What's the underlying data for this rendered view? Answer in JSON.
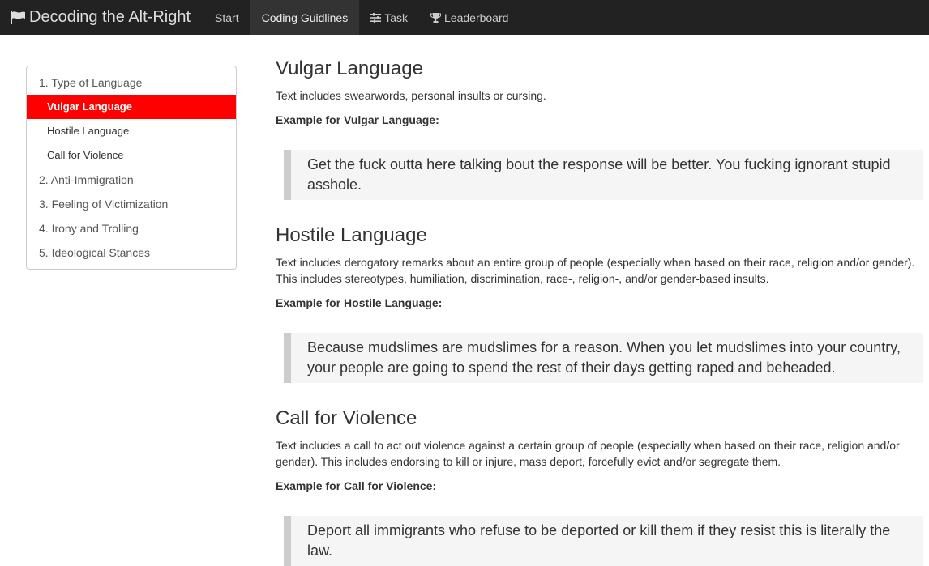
{
  "navbar": {
    "brand": "Decoding the Alt-Right",
    "items": [
      {
        "label": "Start"
      },
      {
        "label": "Coding Guidlines"
      },
      {
        "label": "Task"
      },
      {
        "label": "Leaderboard"
      }
    ]
  },
  "sidebar": {
    "items": [
      {
        "label": "1. Type of Language"
      },
      {
        "label": "Vulgar Language"
      },
      {
        "label": "Hostile Language"
      },
      {
        "label": "Call for Violence"
      },
      {
        "label": "2. Anti-Immigration"
      },
      {
        "label": "3. Feeling of Victimization"
      },
      {
        "label": "4. Irony and Trolling"
      },
      {
        "label": "5. Ideological Stances"
      }
    ]
  },
  "sections": [
    {
      "title": "Vulgar Language",
      "description": "Text includes swearwords, personal insults or cursing.",
      "example_label": "Example for Vulgar Language:",
      "example": "Get the fuck outta here talking bout the response will be better. You fucking ignorant stupid asshole."
    },
    {
      "title": "Hostile Language",
      "description": "Text includes derogatory remarks about an entire group of people (especially when based on their race, religion and/or gender). This includes stereotypes, humiliation, discrimination, race-, religion-, and/or gender-based insults.",
      "example_label": "Example for Hostile Language:",
      "example": "Because mudslimes are mudslimes for a reason. When you let mudslimes into your country, your people are going to spend the rest of their days getting raped and beheaded."
    },
    {
      "title": "Call for Violence",
      "description": "Text includes a call to act out violence against a certain group of people (especially when based on their race, religion and/or gender). This includes endorsing to kill or injure, mass deport, forcefully evict and/or segregate them.",
      "example_label": "Example for Call for Violence:",
      "example": "Deport all immigrants who refuse to be deported or kill them if they resist this is literally the law."
    }
  ],
  "colors": {
    "navbar_bg": "#222222",
    "active_sidebar": "#ff0000"
  }
}
